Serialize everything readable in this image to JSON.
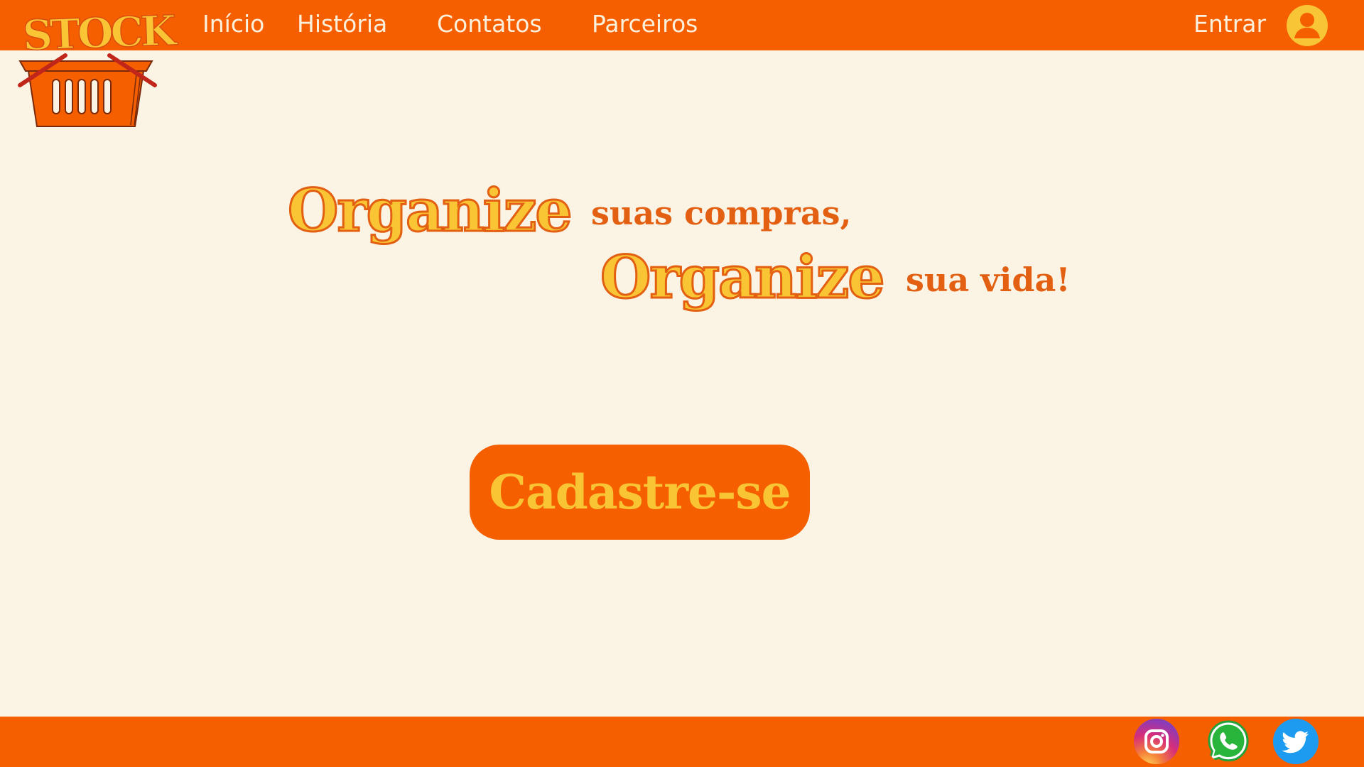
{
  "brand": {
    "logo_text": "STOCK",
    "colors": {
      "primary": "#f55f00",
      "accent": "#f9c534",
      "background": "#fbf4e4"
    }
  },
  "nav": {
    "items": [
      {
        "label": "Início"
      },
      {
        "label": "História"
      },
      {
        "label": "Contatos"
      },
      {
        "label": "Parceiros"
      }
    ],
    "login_label": "Entrar",
    "login_icon": "user-avatar-icon"
  },
  "hero": {
    "line1_big": "Organize",
    "line1_small": "suas compras,",
    "line2_big": "Organize",
    "line2_small": "sua vida!"
  },
  "cta": {
    "label": "Cadastre-se"
  },
  "footer": {
    "social": [
      {
        "icon": "instagram-icon"
      },
      {
        "icon": "whatsapp-icon"
      },
      {
        "icon": "twitter-icon"
      }
    ]
  }
}
